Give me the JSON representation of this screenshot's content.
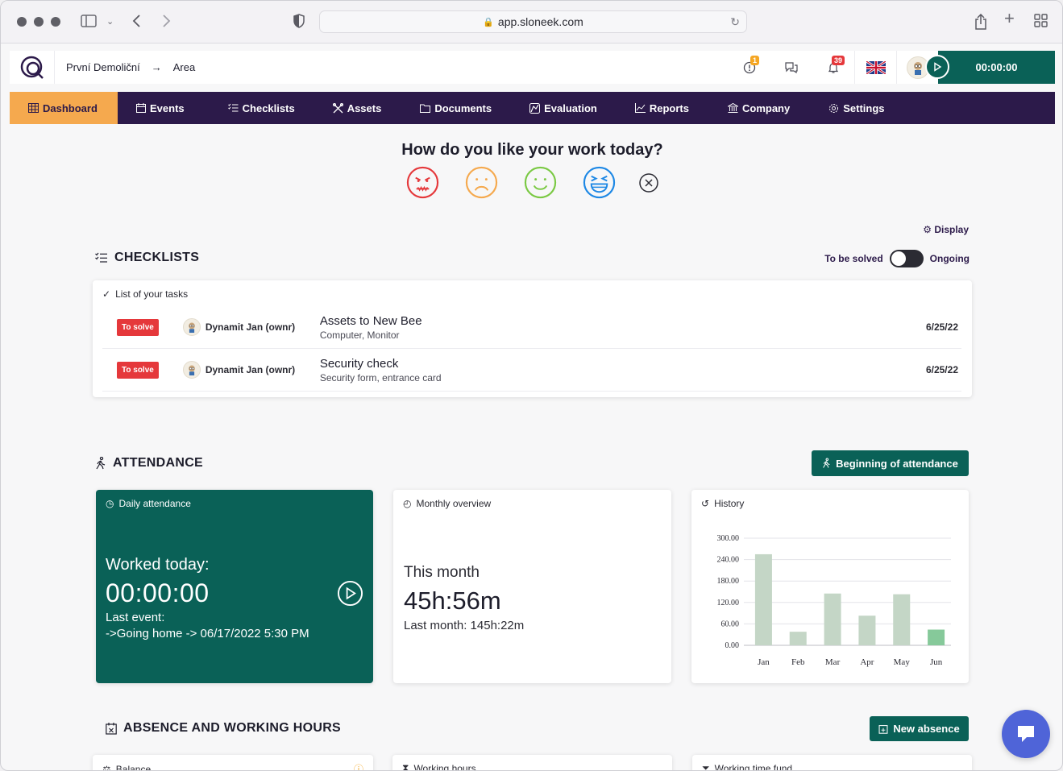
{
  "browser": {
    "url": "app.sloneek.com"
  },
  "header": {
    "breadcrumb": [
      "První Demoliční",
      "Area"
    ],
    "alerts_badge": "1",
    "notifications_badge": "39",
    "timer": "00:00:00"
  },
  "nav": [
    {
      "label": "Dashboard",
      "icon": "grid-icon"
    },
    {
      "label": "Events",
      "icon": "calendar-icon"
    },
    {
      "label": "Checklists",
      "icon": "checklist-icon"
    },
    {
      "label": "Assets",
      "icon": "tools-icon"
    },
    {
      "label": "Documents",
      "icon": "folder-icon"
    },
    {
      "label": "Evaluation",
      "icon": "evaluation-icon"
    },
    {
      "label": "Reports",
      "icon": "chart-icon"
    },
    {
      "label": "Company",
      "icon": "building-icon"
    },
    {
      "label": "Settings",
      "icon": "gear-icon"
    }
  ],
  "mood": {
    "title": "How do you like your work today?"
  },
  "display_label": "Display",
  "checklists": {
    "title": "CHECKLISTS",
    "toggle_left": "To be solved",
    "toggle_right": "Ongoing",
    "card_title": "List of your tasks",
    "tasks": [
      {
        "tag": "To solve",
        "owner": "Dynamit Jan (ownr)",
        "name": "Assets to New Bee",
        "sub": "Computer, Monitor",
        "date": "6/25/22"
      },
      {
        "tag": "To solve",
        "owner": "Dynamit Jan (ownr)",
        "name": "Security check",
        "sub": "Security form, entrance card",
        "date": "6/25/22"
      }
    ]
  },
  "attendance": {
    "title": "ATTENDANCE",
    "begin_button": "Beginning of attendance",
    "daily": {
      "title": "Daily attendance",
      "worked_label": "Worked today:",
      "worked_time": "00:00:00",
      "last_event_label": "Last event:",
      "last_event": "->Going home -> 06/17/2022 5:30 PM"
    },
    "monthly": {
      "title": "Monthly overview",
      "this_month_label": "This month",
      "this_month": "45h:56m",
      "last_month": "Last month: 145h:22m"
    },
    "history_title": "History"
  },
  "chart_data": {
    "type": "bar",
    "categories": [
      "Jan",
      "Feb",
      "Mar",
      "Apr",
      "May",
      "Jun"
    ],
    "values": [
      255,
      38,
      145,
      83,
      143,
      44
    ],
    "yticks": [
      "0.00",
      "60.00",
      "120.00",
      "180.00",
      "240.00",
      "300.00"
    ],
    "ylim": [
      0,
      300
    ],
    "colors": {
      "bar": "#c4d6c6",
      "highlight": "#86c99a"
    }
  },
  "absence": {
    "title": "ABSENCE AND WORKING HOURS",
    "new_button": "New absence",
    "cards": [
      "Balance",
      "Working hours",
      "Working time fund"
    ]
  }
}
